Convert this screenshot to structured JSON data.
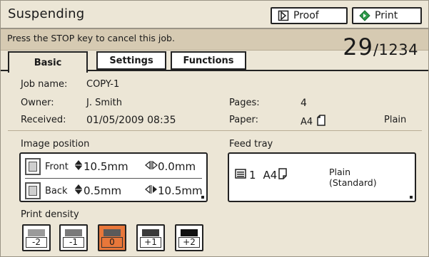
{
  "header": {
    "status": "Suspending",
    "proof_label": "Proof",
    "print_label": "Print"
  },
  "message": "Press the STOP key to cancel this job.",
  "counter": {
    "current": "29",
    "total": "/1234"
  },
  "tabs": [
    {
      "label": "Basic",
      "active": true
    },
    {
      "label": "Settings",
      "active": false
    },
    {
      "label": "Functions",
      "active": false
    }
  ],
  "job": {
    "name_label": "Job name:",
    "name": "COPY-1",
    "owner_label": "Owner:",
    "owner": "J. Smith",
    "received_label": "Received:",
    "received": "01/05/2009 08:35",
    "pages_label": "Pages:",
    "pages": "4",
    "paper_label": "Paper:",
    "paper_size": "A4",
    "paper_type": "Plain"
  },
  "image_position": {
    "title": "Image position",
    "front": {
      "label": "Front",
      "vertical": "10.5mm",
      "horizontal": "0.0mm"
    },
    "back": {
      "label": "Back",
      "vertical": "0.5mm",
      "horizontal": "10.5mm"
    }
  },
  "feed_tray": {
    "title": "Feed tray",
    "tray": "1",
    "size": "A4",
    "type_line1": "Plain",
    "type_line2": "(Standard)"
  },
  "print_density": {
    "title": "Print density",
    "levels": [
      {
        "label": "-2",
        "color": "#9a9a9a"
      },
      {
        "label": "-1",
        "color": "#7a7a7a"
      },
      {
        "label": "0",
        "color": "#5a5a5a",
        "selected": true
      },
      {
        "label": "+1",
        "color": "#3a3a3a"
      },
      {
        "label": "+2",
        "color": "#111111"
      }
    ]
  },
  "colors": {
    "background": "#ece6d6",
    "message_bar": "#d6cab2",
    "selected": "#e8773a"
  }
}
